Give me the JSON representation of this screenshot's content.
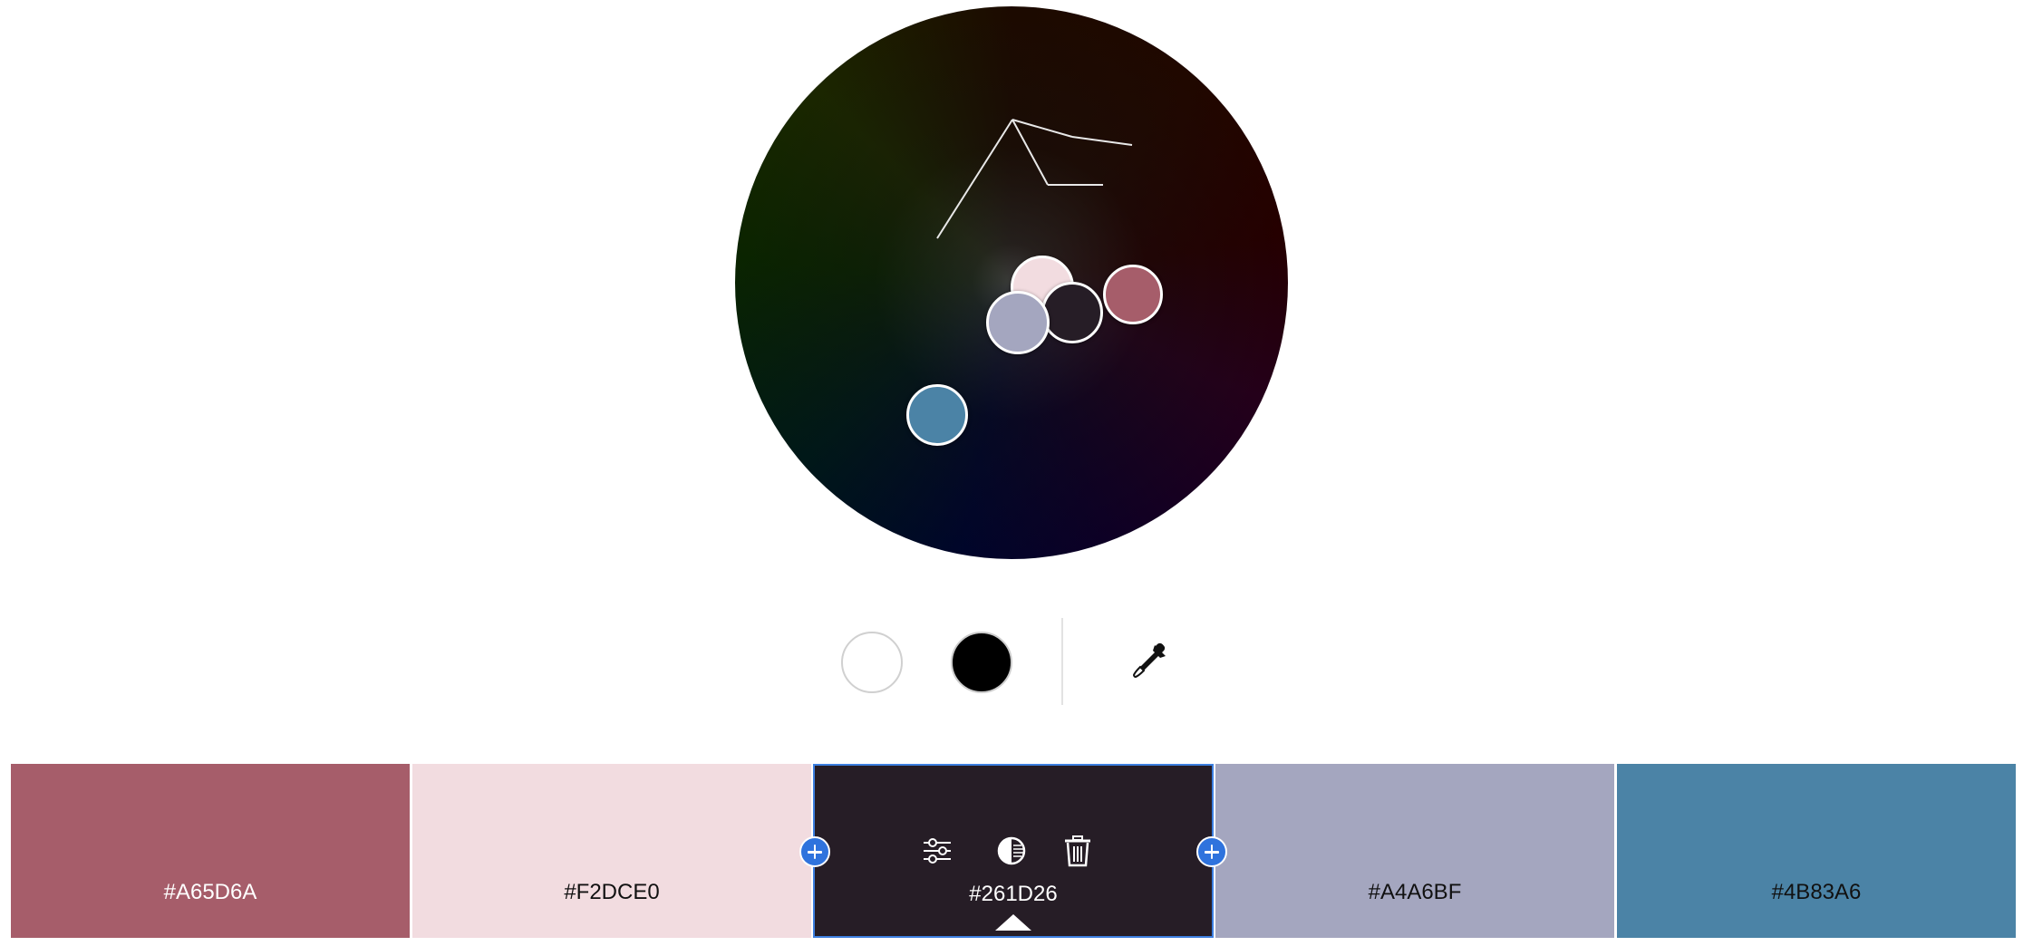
{
  "wheel": {
    "handles": [
      {
        "name": "handle-a65d6a",
        "color": "#A65D6A"
      },
      {
        "name": "handle-f2dce0",
        "color": "#F2DCE0"
      },
      {
        "name": "handle-261d26",
        "color": "#261D26"
      },
      {
        "name": "handle-a4a6bf",
        "color": "#A4A6BF"
      },
      {
        "name": "handle-4b83a6",
        "color": "#4B83A6"
      }
    ]
  },
  "tools": {
    "white": "#FFFFFF",
    "black": "#000000",
    "eyedropper_icon": "eyedropper-icon"
  },
  "swatches": [
    {
      "hex": "#A65D6A",
      "color": "#A65D6A",
      "text_color": "#ffffff"
    },
    {
      "hex": "#F2DCE0",
      "color": "#F2DCE0",
      "text_color": "#111111"
    },
    {
      "hex": "#261D26",
      "color": "#261D26",
      "text_color": "#ffffff",
      "active": true
    },
    {
      "hex": "#A4A6BF",
      "color": "#A4A6BF",
      "text_color": "#111111"
    },
    {
      "hex": "#4B83A6",
      "color": "#4B83A6",
      "text_color": "#111111"
    }
  ],
  "active_swatch_tools": [
    "sliders-icon",
    "contrast-icon",
    "trash-icon"
  ]
}
